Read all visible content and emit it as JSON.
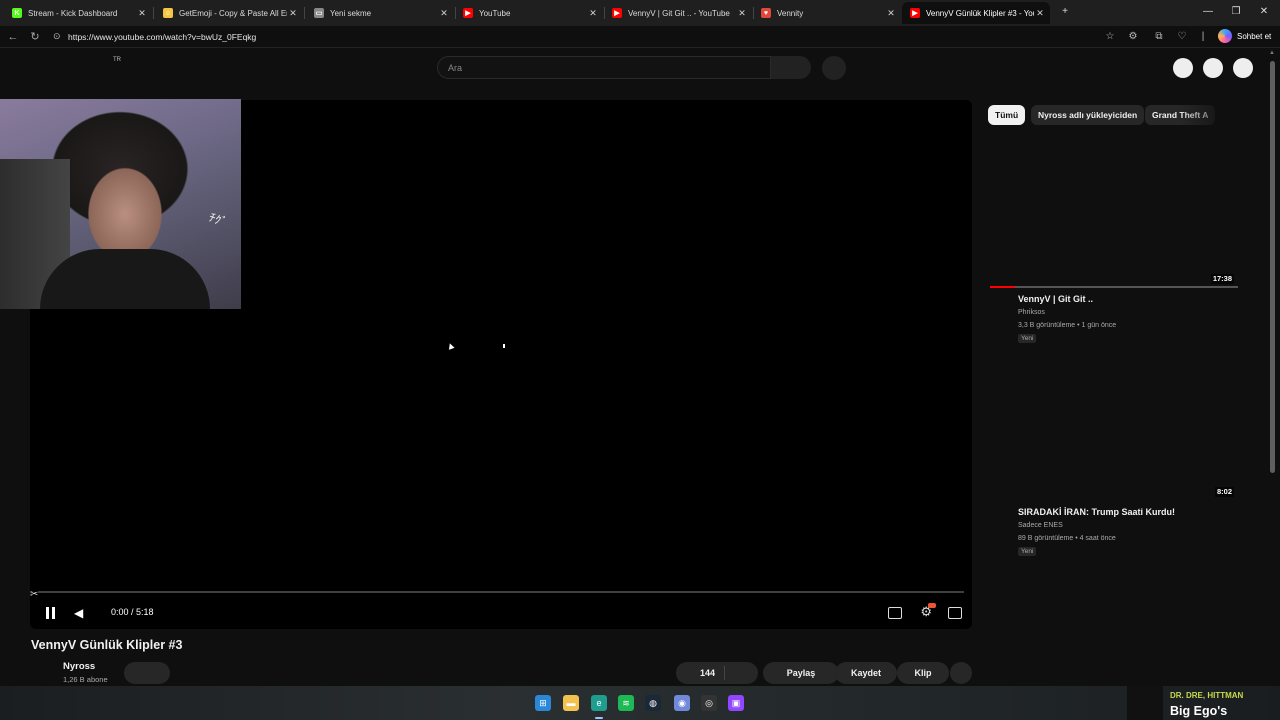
{
  "tabs": [
    {
      "label": "Stream - Kick Dashboard",
      "favicon": "kick-icon",
      "color": "#53fc18",
      "glyph": "K"
    },
    {
      "label": "GetEmoji - Copy & Paste All Emoji",
      "favicon": "emoji-icon",
      "color": "#f5c542",
      "glyph": "☺"
    },
    {
      "label": "Yeni sekme",
      "favicon": "new-tab-icon",
      "color": "#888888",
      "glyph": "▭"
    },
    {
      "label": "YouTube",
      "favicon": "youtube-icon",
      "color": "#ff0000",
      "glyph": "▶"
    },
    {
      "label": "VennyV | Git Git .. - YouTube",
      "favicon": "youtube-icon",
      "color": "#ff0000",
      "glyph": "▶"
    },
    {
      "label": "Vennity",
      "favicon": "vennity-icon",
      "color": "#e0473b",
      "glyph": "♥"
    },
    {
      "label": "VennyV Günlük Klipler #3 - YouTube",
      "favicon": "youtube-icon",
      "color": "#ff0000",
      "glyph": "▶",
      "active": true
    }
  ],
  "address": {
    "url": "https://www.youtube.com/watch?v=bwUz_0FEqkg",
    "copilot_label": "Sohbet et"
  },
  "youtube": {
    "lang_badge": "TR",
    "search_placeholder": "Ara",
    "player": {
      "time": "0:00 / 5:18",
      "progress": 0.0
    },
    "video_title": "VennyV Günlük Klipler #3",
    "channel_name": "Nyross",
    "subscribers": "1,26 B abone",
    "actions": {
      "likes": "144",
      "share": "Paylaş",
      "save": "Kaydet",
      "clip": "Klip"
    },
    "chips": [
      "Tümü",
      "Nyross adlı yükleyiciden",
      "Grand Theft A"
    ],
    "recommendations": [
      {
        "title": "VennyV | Git Git ..",
        "channel": "Phriksos",
        "meta": "3,3 B görüntüleme • 1 gün önce",
        "badge": "Yeni",
        "duration": "17:38",
        "watched": 0.1
      },
      {
        "title": "SIRADAKİ İRAN: Trump Saati Kurdu!",
        "channel": "Sadece ENES",
        "meta": "89 B görüntüleme • 4 saat önce",
        "badge": "Yeni",
        "duration": "8:02",
        "watched": 0.0
      }
    ]
  },
  "taskbar": {
    "apps": [
      "windows-start-icon",
      "file-explorer-icon",
      "edge-icon",
      "spotify-icon",
      "steam-icon",
      "discord-icon",
      "obs-icon",
      "twitch-icon"
    ],
    "now_playing_artist": "DR. DRE, HITTMAN",
    "now_playing_song": "Big Ego's"
  }
}
